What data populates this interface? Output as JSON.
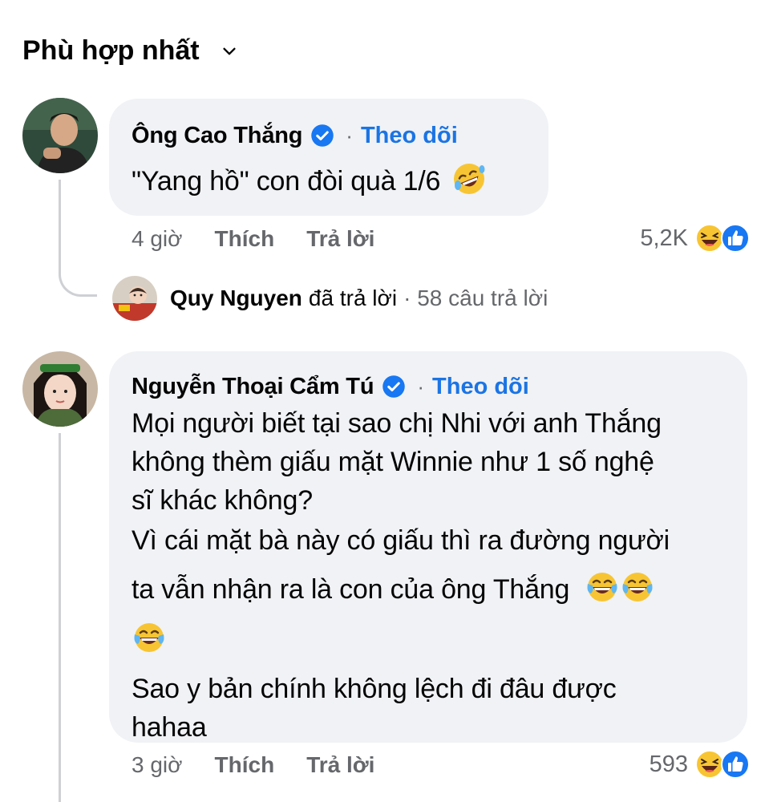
{
  "sort": {
    "label": "Phù hợp nhất"
  },
  "comments": [
    {
      "author": "Ông Cao Thắng",
      "follow_label": "Theo dõi",
      "separator": "·",
      "lines": [
        "\"Yang hồ\" con đòi quà 1/6"
      ],
      "time": "4 giờ",
      "like_label": "Thích",
      "reply_label": "Trả lời",
      "reaction_count": "5,2K",
      "replies": {
        "name": "Quy Nguyen",
        "text": "đã trả lời",
        "count": "· 58 câu trả lời"
      }
    },
    {
      "author": "Nguyễn Thoại Cẩm Tú",
      "follow_label": "Theo dõi",
      "separator": "·",
      "lines": [
        "Mọi người biết tại sao chị Nhi với anh Thắng",
        "không thèm giấu mặt Winnie như 1 số nghệ",
        "sĩ khác không?",
        "Vì cái mặt bà này có giấu thì ra đường người",
        "ta vẫn nhận ra là con của ông Thắng",
        "",
        "Sao y bản chính không lệch đi đâu được",
        "hahaa"
      ],
      "time": "3 giờ",
      "like_label": "Thích",
      "reply_label": "Trả lời",
      "reaction_count": "593"
    }
  ],
  "colors": {
    "link": "#1b74e4",
    "bubble": "#f0f2f5",
    "muted": "#65676b",
    "verified": "#1877f2"
  },
  "icons": {
    "sort": "chevron-down-icon",
    "verified": "verified-badge-icon",
    "haha": "haha-reaction-icon",
    "like": "like-reaction-icon"
  }
}
